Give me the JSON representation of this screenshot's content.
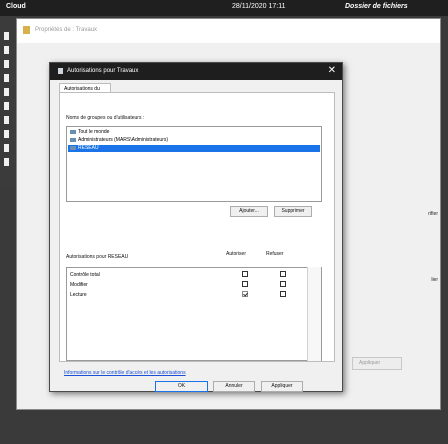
{
  "desktop": {
    "app_label": "Cloud",
    "clock": "28/11/2020 17:11",
    "folder_title": "Dossier de fichiers"
  },
  "background_window": {
    "title": "Propriétés de : Travaux",
    "side_labels": [
      "rifier",
      "lier"
    ],
    "apply_label": "Appliquer"
  },
  "dialog": {
    "title": "Autorisations pour Travaux",
    "close_glyph": "✕",
    "tab_label": "Autorisations du partage",
    "groups_label": "Noms de groupes ou d'utilisateurs :",
    "groups": [
      {
        "name": "Tout le monde",
        "selected": false
      },
      {
        "name": "Administrateurs (MARS\\Administrateurs)",
        "selected": false
      },
      {
        "name": "RESEAU",
        "selected": true
      }
    ],
    "add_label": "Ajouter...",
    "remove_label": "Supprimer",
    "perm_title": "Autorisations pour RESEAU",
    "allow_header": "Autoriser",
    "deny_header": "Refuser",
    "permissions": [
      {
        "name": "Contrôle total",
        "allow": false,
        "deny": false
      },
      {
        "name": "Modifier",
        "allow": false,
        "deny": false
      },
      {
        "name": "Lecture",
        "allow": true,
        "deny": false
      }
    ],
    "info_link": "Informations sur le contrôle d'accès et les autorisations",
    "ok_label": "OK",
    "cancel_label": "Annuler",
    "apply_label": "Appliquer"
  }
}
